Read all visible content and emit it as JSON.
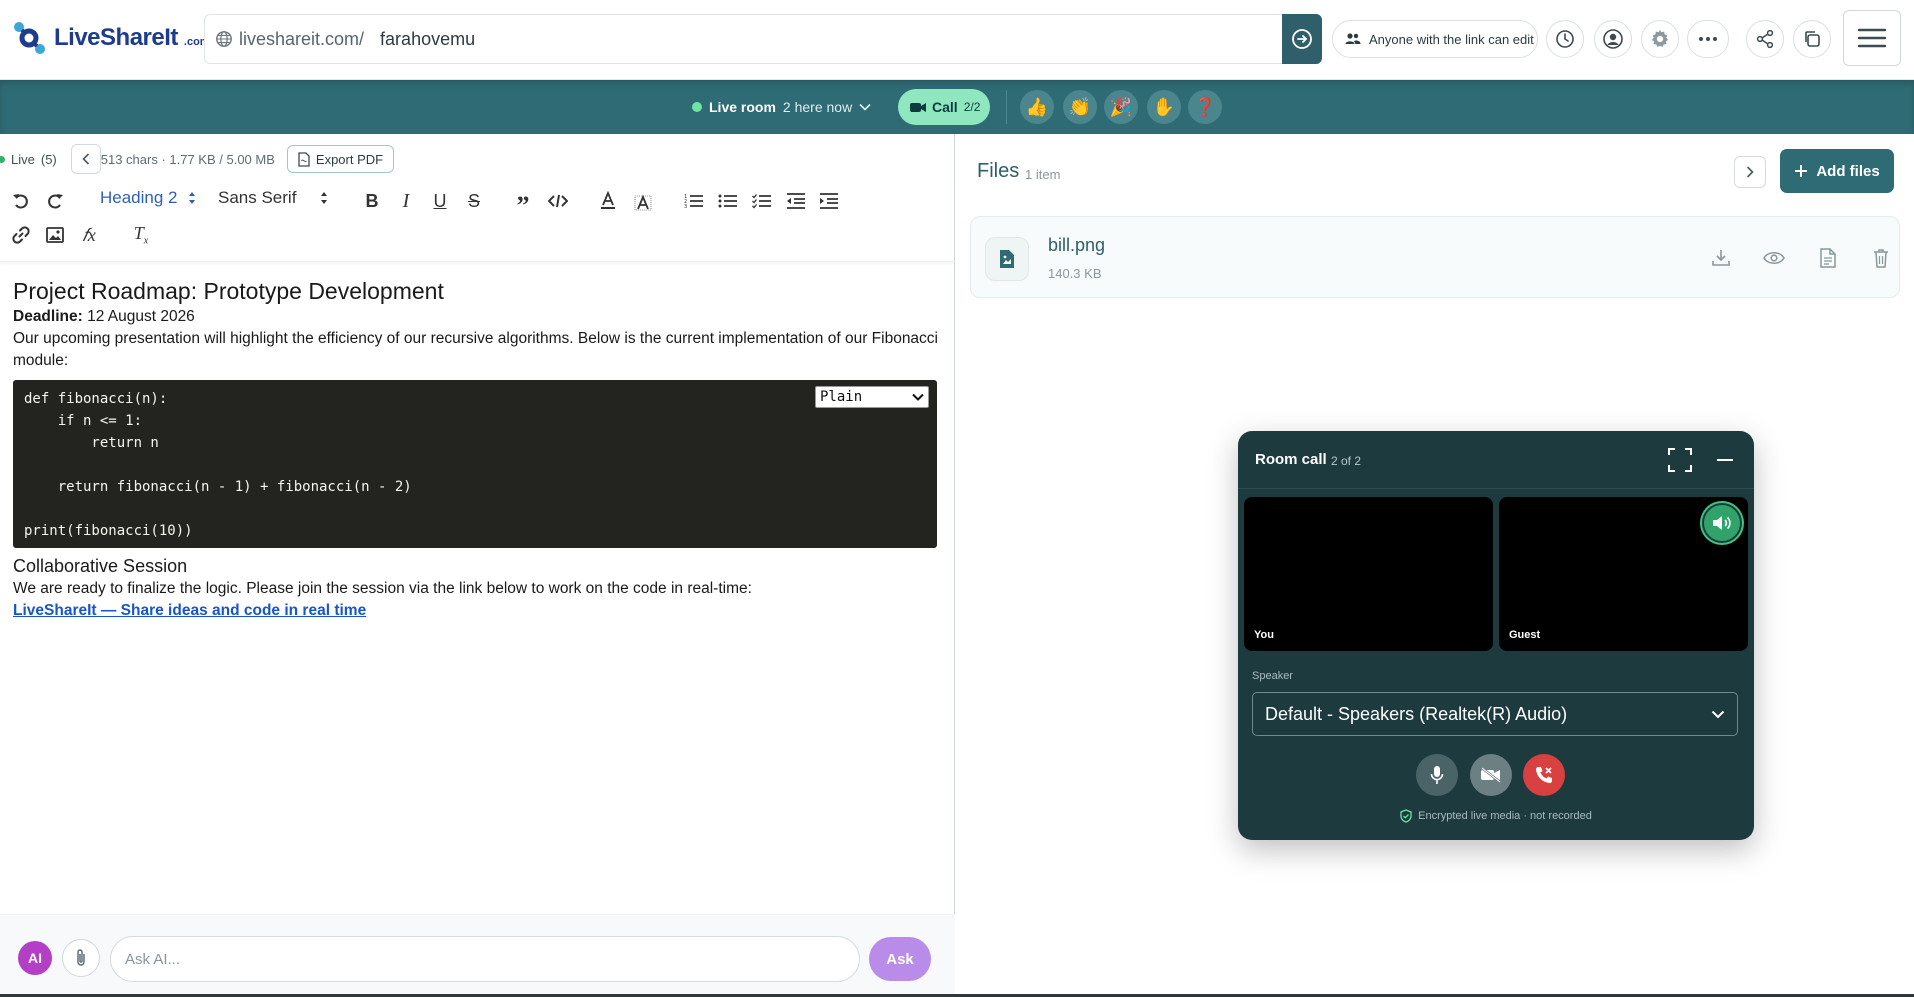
{
  "brand": {
    "name": "LiveShareIt",
    "tld": ".com"
  },
  "url": {
    "prefix": "liveshareit.com/",
    "slug": "farahovemu"
  },
  "share_mode": "Anyone with the link can edit",
  "live": {
    "label": "Live room",
    "here_now": "2 here now",
    "call_label": "Call",
    "call_count": "2/2"
  },
  "reactions": [
    "👍",
    "👏",
    "🎉",
    "✋",
    "❓"
  ],
  "editor": {
    "live_label": "Live",
    "live_count": "(5)",
    "stats": "513 chars · 1.77 KB / 5.00 MB",
    "export_label": "Export PDF",
    "heading_select": "Heading 2",
    "font_select": "Sans Serif"
  },
  "doc": {
    "title": "Project Roadmap: Prototype Development",
    "deadline_label": "Deadline:",
    "deadline_value": " 12 August 2026",
    "intro": "Our upcoming presentation will highlight the efficiency of our recursive algorithms. Below is the current implementation of our Fibonacci module:",
    "code": "def fibonacci(n):\n    if n <= 1:\n        return n\n\n    return fibonacci(n - 1) + fibonacci(n - 2)\n\nprint(fibonacci(10))",
    "code_lang": "Plain",
    "section_title": "Collaborative Session",
    "section_text": "We are ready to finalize the logic. Please join the session via the link below to work on the code in real-time:",
    "link_text": "LiveShareIt — Share ideas and code in real time"
  },
  "ask": {
    "ai_badge": "AI",
    "placeholder": "Ask AI...",
    "button": "Ask"
  },
  "files": {
    "title": "Files",
    "count": "1 item",
    "add_label": "Add files",
    "items": [
      {
        "name": "bill.png",
        "size": "140.3 KB"
      }
    ]
  },
  "call": {
    "title": "Room call",
    "count": "2 of 2",
    "tiles": [
      "You",
      "Guest"
    ],
    "speaker_label": "Speaker",
    "speaker_device": "Default - Speakers (Realtek(R) Audio)",
    "encrypted_note": "Encrypted live media · not recorded"
  },
  "colors": {
    "primary": "#2f6b74",
    "live_green": "#6fe3a2",
    "call_pill": "#8fe7c0",
    "danger": "#d94040",
    "ai_purple": "#b43fc7"
  }
}
